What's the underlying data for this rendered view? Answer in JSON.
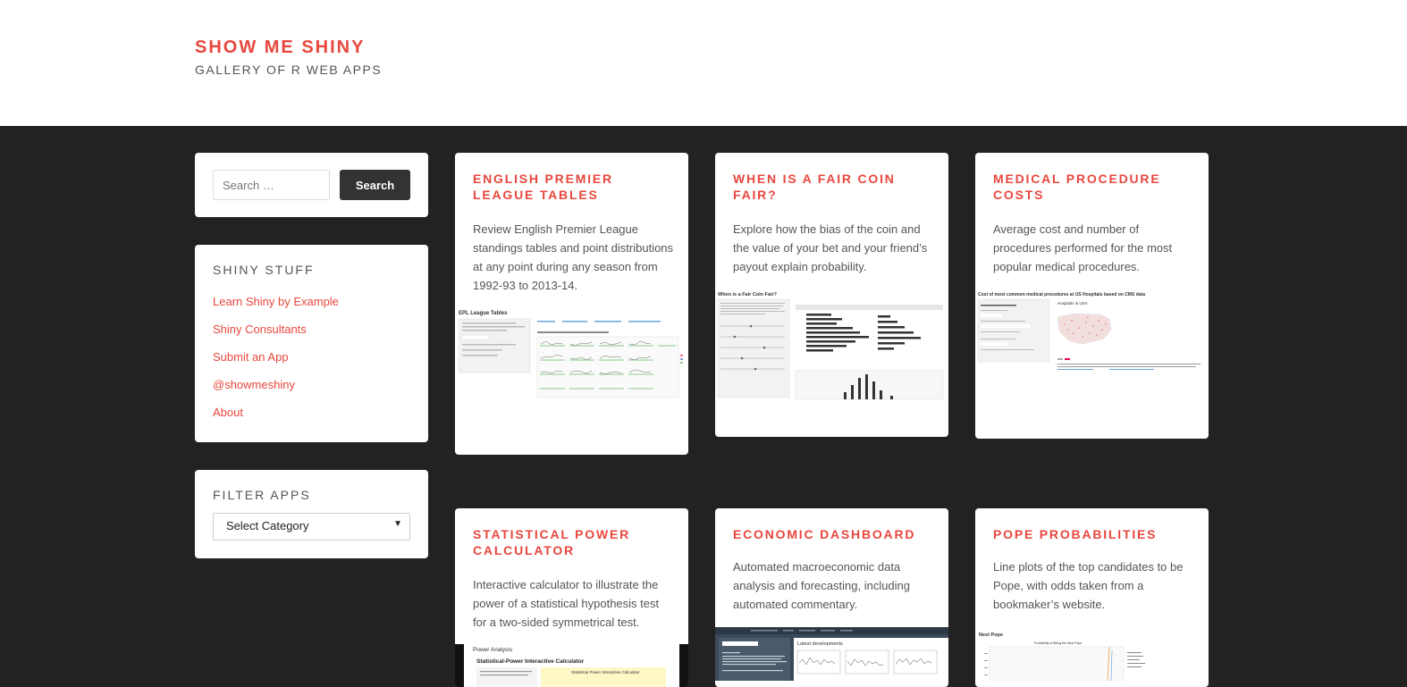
{
  "site": {
    "title": "SHOW ME SHINY",
    "description": "GALLERY OF R WEB APPS"
  },
  "search": {
    "placeholder": "Search …",
    "button_label": "Search"
  },
  "shiny_stuff": {
    "title": "SHINY STUFF",
    "links": [
      {
        "label": "Learn Shiny by Example"
      },
      {
        "label": "Shiny Consultants"
      },
      {
        "label": "Submit an App"
      },
      {
        "label": "@showmeshiny"
      },
      {
        "label": "About"
      }
    ]
  },
  "filter": {
    "title": "FILTER APPS",
    "selected": "Select Category"
  },
  "colors": {
    "accent": "#e8473e",
    "background": "#222222",
    "card": "#ffffff"
  },
  "apps": [
    {
      "title": "ENGLISH PREMIER LEAGUE TABLES",
      "description": "Review English Premier League standings tables and point distributions at any point during any season from 1992-93 to 2013-14.",
      "thumb_title": "EPL League Tables"
    },
    {
      "title": "WHEN IS A FAIR COIN FAIR?",
      "description": "Explore how the bias of the coin and the value of your bet and your friend’s payout explain probability.",
      "thumb_title": "When is a Fair Coin Fair?"
    },
    {
      "title": "MEDICAL PROCEDURE COSTS",
      "description": "Average cost and number of procedures performed for the most popular medical procedures.",
      "thumb_title": "Cost of most common medical procedures at US Hospitals based on CMS data"
    },
    {
      "title": "STATISTICAL POWER CALCULATOR",
      "description": "Interactive calculator to illustrate the power of a statistical hypothesis test for a two-sided symmetrical test.",
      "thumb_title": "Power Analysis",
      "thumb_subtitle": "Statistical-Power Interactive Calculator"
    },
    {
      "title": "ECONOMIC DASHBOARD",
      "description": "Automated macroeconomic data analysis and forecasting, including automated commentary.",
      "thumb_title": "Latest developments"
    },
    {
      "title": "POPE PROBABILITIES",
      "description": "Line plots of the top candidates to be Pope, with odds taken from a bookmaker’s website.",
      "thumb_title": "Next Pope"
    }
  ]
}
